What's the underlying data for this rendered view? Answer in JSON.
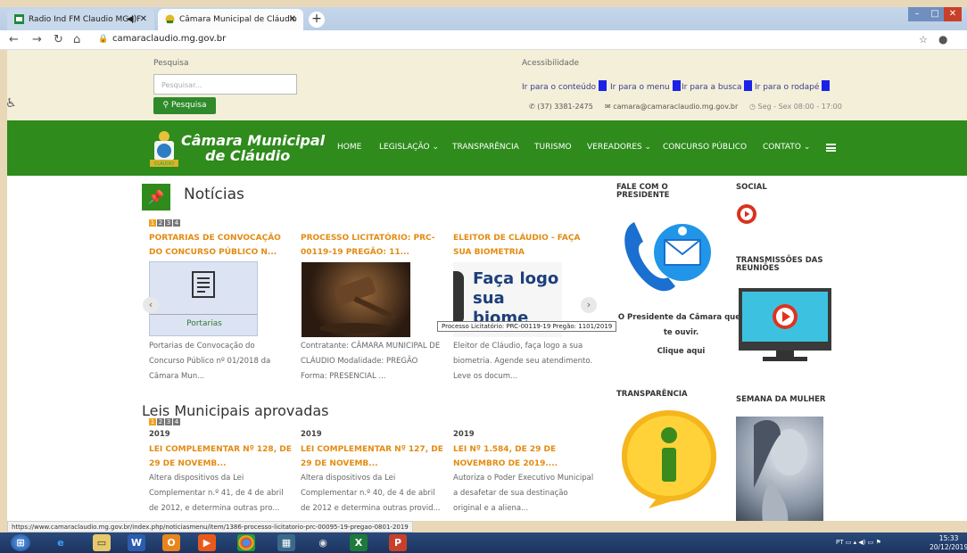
{
  "browser": {
    "tabs": [
      {
        "label": "Radio Ind FM Claudio MG | F"
      },
      {
        "label": "Câmara Municipal de Cláudio"
      }
    ],
    "url": "camaraclaudio.mg.gov.br",
    "status_url": "https://www.camaraclaudio.mg.gov.br/index.php/noticiasmenu/item/1386-processo-licitatorio-prc-00095-19-pregao-0801-2019"
  },
  "topbar": {
    "search_label": "Pesquisa",
    "search_placeholder": "Pesquisar...",
    "search_button": "Pesquisa",
    "accessibility_label": "Acessibilidade",
    "skip_links": [
      "Ir para o conteúdo",
      "Ir para o menu",
      "Ir para a busca",
      "Ir para o rodapé"
    ],
    "phone": "(37) 3381-2475",
    "email": "camara@camaraclaudio.mg.gov.br",
    "hours": "Seg - Sex 08:00 - 17:00"
  },
  "header": {
    "brand_line1": "Câmara Municipal",
    "brand_line2": "de Cláudio",
    "logo_text": "CLÁUDIO",
    "menu": [
      "HOME",
      "LEGISLAÇÃO",
      "TRANSPARÊNCIA",
      "TURISMO",
      "VEREADORES",
      "CONCURSO PÚBLICO",
      "CONTATO"
    ]
  },
  "news": {
    "title": "Notícias",
    "pages": [
      "1",
      "2",
      "3",
      "4"
    ],
    "items": [
      {
        "title": "PORTARIAS DE CONVOCAÇÃO DO CONCURSO PÚBLICO N...",
        "thumb_text": "Portarias",
        "desc": "Portarias de Convocação do Concurso Público nº 01/2018 da Câmara Mun..."
      },
      {
        "title": "PROCESSO LICITATÓRIO: PRC-00119-19 PREGÃO: 11...",
        "thumb_text": "",
        "desc": "Contratante: CÂMARA MUNICIPAL DE CLÁUDIO Modalidade: PREGÃO Forma: PRESENCIAL ..."
      },
      {
        "title": "ELEITOR DE CLÁUDIO - FAÇA SUA BIOMETRIA",
        "thumb_text": "Faça logo sua biome",
        "desc": "Eleitor de Cláudio, faça logo a sua biometria. Agende seu atendimento. Leve os docum..."
      }
    ],
    "tooltip": "Processo Licitatório: PRC-00119-19 Pregão: 1101/2019"
  },
  "laws": {
    "title": "Leis Municipais aprovadas",
    "pages": [
      "1",
      "2",
      "3",
      "4"
    ],
    "items": [
      {
        "year": "2019",
        "title": "LEI COMPLEMENTAR Nº 128, DE 29 DE NOVEMB...",
        "desc": "Altera dispositivos da Lei Complementar n.º 41, de 4 de abril de 2012, e determina outras pro..."
      },
      {
        "year": "2019",
        "title": "LEI COMPLEMENTAR Nº 127, DE 29 DE NOVEMB...",
        "desc": "Altera dispositivos da Lei Complementar n.º 40, de 4 de abril de 2012 e determina outras provid..."
      },
      {
        "year": "2019",
        "title": "LEI Nº 1.584, DE 29 DE NOVEMBRO DE 2019....",
        "desc": "Autoriza o Poder Executivo Municipal a desafetar de sua destinação original e a aliena..."
      }
    ]
  },
  "sidebar": {
    "fale_title": "FALE COM O PRESIDENTE",
    "fale_text": "O Presidente da Câmara quer te ouvir.",
    "fale_link": "Clique aqui",
    "social_title": "SOCIAL",
    "transmissoes_title": "TRANSMISSÕES DAS REUNIÕES",
    "transparencia_title": "TRANSPARÊNCIA",
    "semana_title": "SEMANA DA MULHER"
  },
  "taskbar": {
    "tray_lang": "PT",
    "time": "15:33",
    "date": "20/12/2019"
  },
  "colors": {
    "green": "#2e8b1c",
    "orange": "#e38b12",
    "skip_blue": "#1a22e8"
  }
}
